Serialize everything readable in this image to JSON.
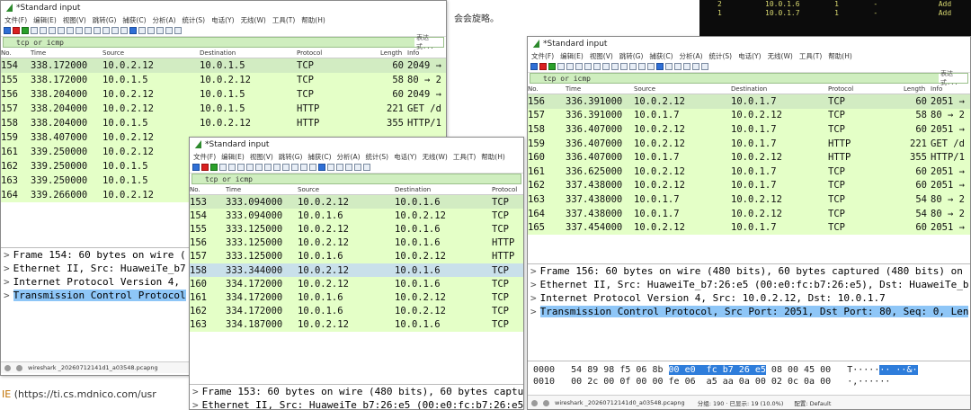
{
  "background": {
    "doc_text": "会会旋略。",
    "link_prefix": "IE",
    "link_text": "https://ti.cs.mdnico.com/usr",
    "terminal_lines": [
      {
        "a": "2",
        "b": "10.0.1.6",
        "c": "1",
        "d": "-",
        "e": "Add"
      },
      {
        "a": "1",
        "b": "10.0.1.7",
        "c": "1",
        "d": "-",
        "e": "Add"
      }
    ]
  },
  "windows": [
    {
      "title": "*Standard input",
      "menu": [
        "文件(F)",
        "编辑(E)",
        "视图(V)",
        "跳转(G)",
        "捕获(C)",
        "分析(A)",
        "统计(S)",
        "电话(Y)",
        "无线(W)",
        "工具(T)",
        "帮助(H)"
      ],
      "filter": "tcp or icmp",
      "filter_expr": "表达式...",
      "columns": [
        "No.",
        "Time",
        "Source",
        "Destination",
        "Protocol",
        "Length",
        "Info"
      ],
      "packets": [
        {
          "no": "154",
          "time": "338.172000",
          "src": "10.0.2.12",
          "dst": "10.0.1.5",
          "proto": "TCP",
          "len": "60",
          "info": "2049 →"
        },
        {
          "no": "155",
          "time": "338.172000",
          "src": "10.0.1.5",
          "dst": "10.0.2.12",
          "proto": "TCP",
          "len": "58",
          "info": "80 → 2"
        },
        {
          "no": "156",
          "time": "338.204000",
          "src": "10.0.2.12",
          "dst": "10.0.1.5",
          "proto": "TCP",
          "len": "60",
          "info": "2049 →"
        },
        {
          "no": "157",
          "time": "338.204000",
          "src": "10.0.2.12",
          "dst": "10.0.1.5",
          "proto": "HTTP",
          "len": "221",
          "info": "GET /d"
        },
        {
          "no": "158",
          "time": "338.204000",
          "src": "10.0.1.5",
          "dst": "10.0.2.12",
          "proto": "HTTP",
          "len": "355",
          "info": "HTTP/1"
        },
        {
          "no": "159",
          "time": "338.407000",
          "src": "10.0.2.12",
          "dst": "",
          "proto": "",
          "len": "",
          "info": ""
        },
        {
          "no": "161",
          "time": "339.250000",
          "src": "10.0.2.12",
          "dst": "",
          "proto": "",
          "len": "",
          "info": ""
        },
        {
          "no": "162",
          "time": "339.250000",
          "src": "10.0.1.5",
          "dst": "",
          "proto": "",
          "len": "",
          "info": ""
        },
        {
          "no": "163",
          "time": "339.250000",
          "src": "10.0.1.5",
          "dst": "",
          "proto": "",
          "len": "",
          "info": ""
        },
        {
          "no": "164",
          "time": "339.266000",
          "src": "10.0.2.12",
          "dst": "",
          "proto": "",
          "len": "",
          "info": ""
        }
      ],
      "details": [
        "Frame 154: 60 bytes on wire (",
        "Ethernet II, Src: HuaweiTe_b7",
        "Internet Protocol Version 4,",
        "Transmission Control Protocol"
      ],
      "status_file": "wireshark _20260712141d1_a03548.pcapng"
    },
    {
      "title": "*Standard input",
      "menu": [
        "文件(F)",
        "编辑(E)",
        "视图(V)",
        "跳转(G)",
        "捕获(C)",
        "分析(A)",
        "统计(S)",
        "电话(Y)",
        "无线(W)",
        "工具(T)",
        "帮助(H)"
      ],
      "filter": "tcp or icmp",
      "columns": [
        "No.",
        "Time",
        "Source",
        "Destination",
        "Protocol"
      ],
      "packets": [
        {
          "no": "153",
          "time": "333.094000",
          "src": "10.0.2.12",
          "dst": "10.0.1.6",
          "proto": "TCP"
        },
        {
          "no": "154",
          "time": "333.094000",
          "src": "10.0.1.6",
          "dst": "10.0.2.12",
          "proto": "TCP"
        },
        {
          "no": "155",
          "time": "333.125000",
          "src": "10.0.2.12",
          "dst": "10.0.1.6",
          "proto": "TCP"
        },
        {
          "no": "156",
          "time": "333.125000",
          "src": "10.0.2.12",
          "dst": "10.0.1.6",
          "proto": "HTTP"
        },
        {
          "no": "157",
          "time": "333.125000",
          "src": "10.0.1.6",
          "dst": "10.0.2.12",
          "proto": "HTTP"
        },
        {
          "no": "158",
          "time": "333.344000",
          "src": "10.0.2.12",
          "dst": "10.0.1.6",
          "proto": "TCP"
        },
        {
          "no": "160",
          "time": "334.172000",
          "src": "10.0.2.12",
          "dst": "10.0.1.6",
          "proto": "TCP"
        },
        {
          "no": "161",
          "time": "334.172000",
          "src": "10.0.1.6",
          "dst": "10.0.2.12",
          "proto": "TCP"
        },
        {
          "no": "162",
          "time": "334.172000",
          "src": "10.0.1.6",
          "dst": "10.0.2.12",
          "proto": "TCP"
        },
        {
          "no": "163",
          "time": "334.187000",
          "src": "10.0.2.12",
          "dst": "10.0.1.6",
          "proto": "TCP"
        }
      ],
      "details": [
        "Frame 153: 60 bytes on wire (480 bits), 60 bytes captu",
        "Ethernet II, Src: HuaweiTe_b7:26:e5 (00:e0:fc:b7:26:e5), Dst: HuaweiTe_"
      ]
    },
    {
      "title": "*Standard input",
      "menu": [
        "文件(F)",
        "编辑(E)",
        "视图(V)",
        "跳转(G)",
        "捕获(C)",
        "分析(A)",
        "统计(S)",
        "电话(Y)",
        "无线(W)",
        "工具(T)",
        "帮助(H)"
      ],
      "filter": "tcp or icmp",
      "filter_expr": "表达式...",
      "columns": [
        "No.",
        "Time",
        "Source",
        "Destination",
        "Protocol",
        "Length",
        "Info"
      ],
      "packets": [
        {
          "no": "156",
          "time": "336.391000",
          "src": "10.0.2.12",
          "dst": "10.0.1.7",
          "proto": "TCP",
          "len": "60",
          "info": "2051 →"
        },
        {
          "no": "157",
          "time": "336.391000",
          "src": "10.0.1.7",
          "dst": "10.0.2.12",
          "proto": "TCP",
          "len": "58",
          "info": "80 → 2"
        },
        {
          "no": "158",
          "time": "336.407000",
          "src": "10.0.2.12",
          "dst": "10.0.1.7",
          "proto": "TCP",
          "len": "60",
          "info": "2051 →"
        },
        {
          "no": "159",
          "time": "336.407000",
          "src": "10.0.2.12",
          "dst": "10.0.1.7",
          "proto": "HTTP",
          "len": "221",
          "info": "GET /d"
        },
        {
          "no": "160",
          "time": "336.407000",
          "src": "10.0.1.7",
          "dst": "10.0.2.12",
          "proto": "HTTP",
          "len": "355",
          "info": "HTTP/1"
        },
        {
          "no": "161",
          "time": "336.625000",
          "src": "10.0.2.12",
          "dst": "10.0.1.7",
          "proto": "TCP",
          "len": "60",
          "info": "2051 →"
        },
        {
          "no": "162",
          "time": "337.438000",
          "src": "10.0.2.12",
          "dst": "10.0.1.7",
          "proto": "TCP",
          "len": "60",
          "info": "2051 →"
        },
        {
          "no": "163",
          "time": "337.438000",
          "src": "10.0.1.7",
          "dst": "10.0.2.12",
          "proto": "TCP",
          "len": "54",
          "info": "80 → 2"
        },
        {
          "no": "164",
          "time": "337.438000",
          "src": "10.0.1.7",
          "dst": "10.0.2.12",
          "proto": "TCP",
          "len": "54",
          "info": "80 → 2"
        },
        {
          "no": "165",
          "time": "337.454000",
          "src": "10.0.2.12",
          "dst": "10.0.1.7",
          "proto": "TCP",
          "len": "60",
          "info": "2051 →"
        }
      ],
      "details": [
        "Frame 156: 60 bytes on wire (480 bits), 60 bytes captured (480 bits) on",
        "Ethernet II, Src: HuaweiTe_b7:26:e5 (00:e0:fc:b7:26:e5), Dst: HuaweiTe_b",
        "Internet Protocol Version 4, Src: 10.0.2.12, Dst: 10.0.1.7",
        "Transmission Control Protocol, Src Port: 2051, Dst Port: 80, Seq: 0, Len"
      ],
      "hex": [
        {
          "offset": "0000",
          "pre": "54 89 98 f5 06 8b ",
          "hl": "00 e0  fc b7 26 e5",
          "post": " 08 00 45 00   T·····",
          "ascii_hl": "·· ··&·"
        },
        {
          "offset": "0010",
          "pre": "00 2c 00 0f 00 00 fe 06  a5 aa 0a 00 02 0c 0a 00",
          "hl": "",
          "post": "   ·,······",
          "ascii_hl": ""
        }
      ],
      "status_file": "wireshark _20260712141d0_a03548.pcapng",
      "status_packets": "分组: 190 · 已显示: 19 (10.0%)",
      "status_profile": "配置: Default"
    }
  ],
  "colors": {
    "packet_row": "#e4ffc7",
    "selected_row": "#c9e0ea",
    "detail_highlight": "#8ec6f7",
    "filter_bg": "#cfeebf",
    "hex_highlight": "#2e7ddb"
  }
}
